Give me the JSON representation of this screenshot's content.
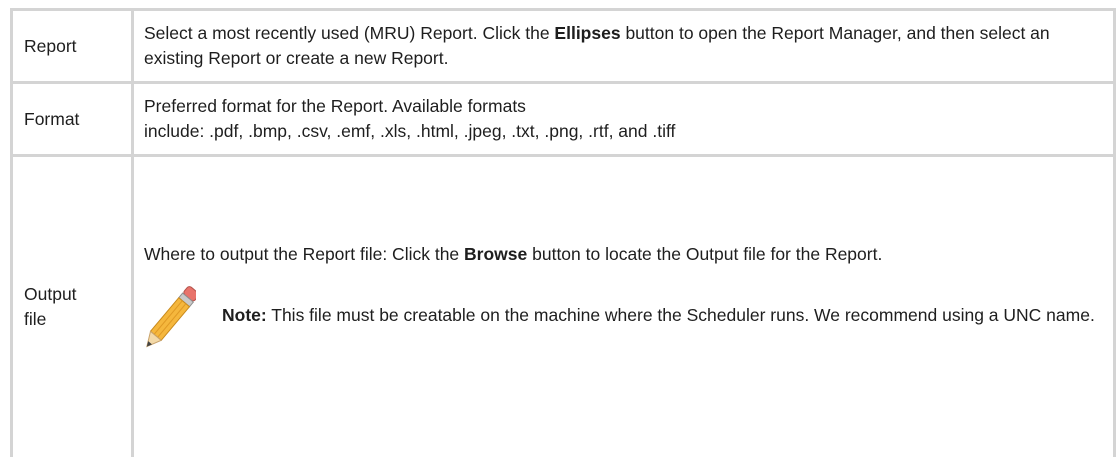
{
  "rows": [
    {
      "name": "Report",
      "text_before": "Select a most recently used (MRU) Report. Click the ",
      "bold": "Ellipses",
      "text_after": " button to open the Report Manager, and then select an existing Report or create a new Report."
    },
    {
      "name": "Format",
      "line1": "Preferred format for the Report. Available formats",
      "line2": "include: .pdf, .bmp, .csv, .emf, .xls, .html, .jpeg, .txt, .png, .rtf, and .tiff"
    },
    {
      "name": "Output file",
      "text_before": "Where to output the Report file: Click the ",
      "bold": "Browse",
      "text_after": " button to locate the Output file for the Report.",
      "note_label": "Note:",
      "note_text": " This file must be creatable on the machine where the Scheduler runs. We recommend using a UNC name.",
      "note_icon": "pencil-icon"
    }
  ],
  "colors": {
    "border": "#d4d4d4",
    "text": "#1e1e1e",
    "pencil_body": "#f5b73d",
    "pencil_eraser": "#e8736b"
  }
}
